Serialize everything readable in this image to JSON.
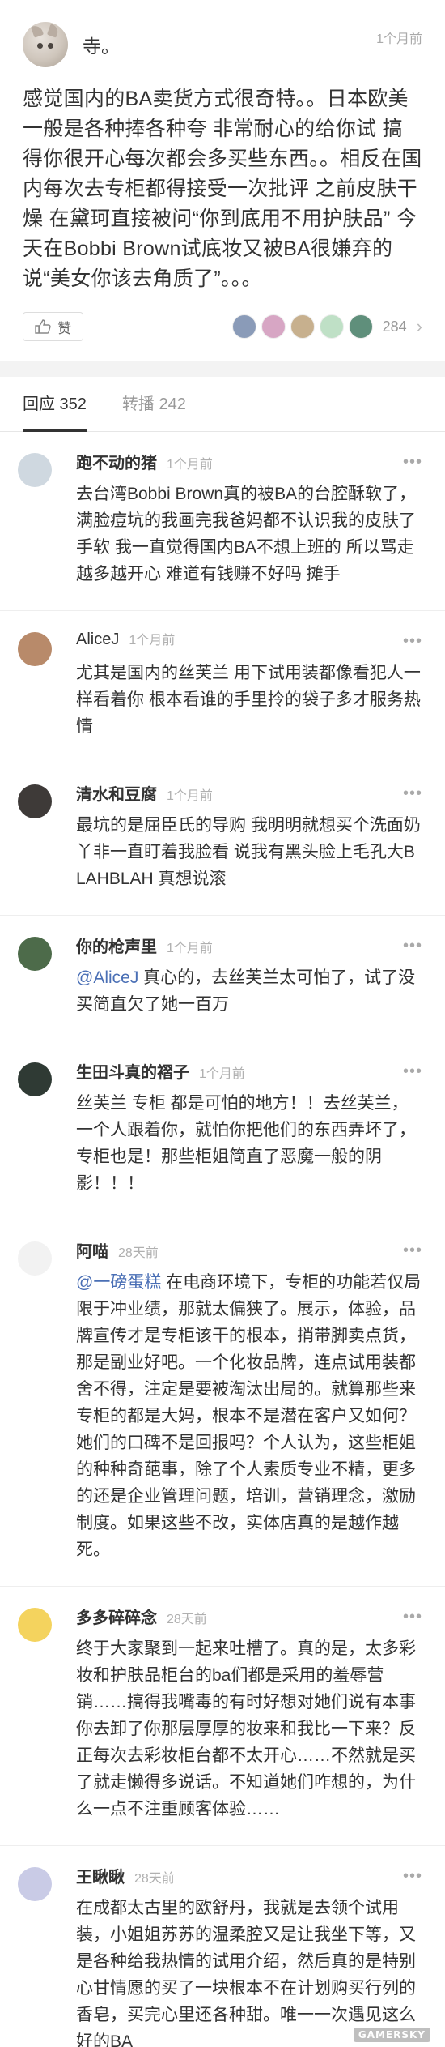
{
  "post": {
    "author": "寺。",
    "time": "1个月前",
    "body": "感觉国内的BA卖货方式很奇特。。日本欧美一般是各种捧各种夸 非常耐心的给你试 搞得你很开心每次都会多买些东西。。相反在国内每次去专柜都得接受一次批评 之前皮肤干燥 在黛珂直接被问“你到底用不用护肤品” 今天在Bobbi Brown试底妆又被BA很嫌弃的说“美女你该去角质了”。。。",
    "like_label": "赞",
    "like_count": "284",
    "liker_colors": [
      "#8a9bb8",
      "#d7a6c4",
      "#c7b08e",
      "#bfe0c6",
      "#5f8f7b"
    ]
  },
  "tabs": [
    {
      "label": "回应 352",
      "active": true
    },
    {
      "label": "转播 242",
      "active": false
    }
  ],
  "comments": [
    {
      "name": "跑不动的猪",
      "time": "1个月前",
      "text": "去台湾Bobbi Brown真的被BA的台腔酥软了，满脸痘坑的我画完我爸妈都不认识我的皮肤了 手软 我一直觉得国内BA不想上班的 所以骂走越多越开心 难道有钱赚不好吗 摊手",
      "avatar_color": "#cfd8e0"
    },
    {
      "name": "AliceJ",
      "time": "1个月前",
      "text": "尤其是国内的丝芙兰 用下试用装都像看犯人一样看着你 根本看谁的手里拎的袋子多才服务热情",
      "avatar_color": "#b88a6a"
    },
    {
      "name": "清水和豆腐",
      "time": "1个月前",
      "text": "最坑的是屈臣氏的导购 我明明就想买个洗面奶 丫非一直盯着我脸看 说我有黑头脸上毛孔大BLAHBLAH 真想说滚",
      "avatar_color": "#3e3a38"
    },
    {
      "name": "你的枪声里",
      "time": "1个月前",
      "mention": "@AliceJ",
      "text": " 真心的，去丝芙兰太可怕了，试了没买简直欠了她一百万",
      "avatar_color": "#4d6b4a"
    },
    {
      "name": "生田斗真的褶子",
      "time": "1个月前",
      "text": "丝芙兰 专柜 都是可怕的地方！！去丝芙兰，一个人跟着你，就怕你把他们的东西弄坏了，专柜也是！那些柜姐简直了恶魔一般的阴影！！！",
      "avatar_color": "#2f3a34"
    },
    {
      "name": "阿喵",
      "time": "28天前",
      "mention": "@一磅蛋糕",
      "text": " 在电商环境下，专柜的功能若仅局限于冲业绩，那就太偏狭了。展示，体验，品牌宣传才是专柜该干的根本，捎带脚卖点货，那是副业好吧。一个化妆品牌，连点试用装都舍不得，注定是要被淘汰出局的。就算那些来专柜的都是大妈，根本不是潜在客户又如何？她们的口碑不是回报吗？个人认为，这些柜姐的种种奇葩事，除了个人素质专业不精，更多的还是企业管理问题，培训，营销理念，激励制度。如果这些不改，实体店真的是越作越死。",
      "avatar_color": "#f2f2f2"
    },
    {
      "name": "多多碎碎念",
      "time": "28天前",
      "text": "终于大家聚到一起来吐槽了。真的是，太多彩妆和护肤品柜台的ba们都是采用的羞辱营销……搞得我嘴毒的有时好想对她们说有本事你去卸了你那层厚厚的妆来和我比一下来？反正每次去彩妆柜台都不太开心……不然就是买了就走懒得多说话。不知道她们咋想的，为什么一点不注重顾客体验……",
      "avatar_color": "#f4d35e"
    },
    {
      "name": "王瞅瞅",
      "time": "28天前",
      "text": "在成都太古里的欧舒丹，我就是去领个试用装，小姐姐苏苏的温柔腔又是让我坐下等，又是各种给我热情的试用介绍，然后真的是特别心甘情愿的买了一块根本不在计划购买行列的香皂，买完心里还各种甜。唯一一次遇见这么好的BA",
      "avatar_color": "#c9cbe6"
    }
  ],
  "watermark": "GAMERSKY"
}
